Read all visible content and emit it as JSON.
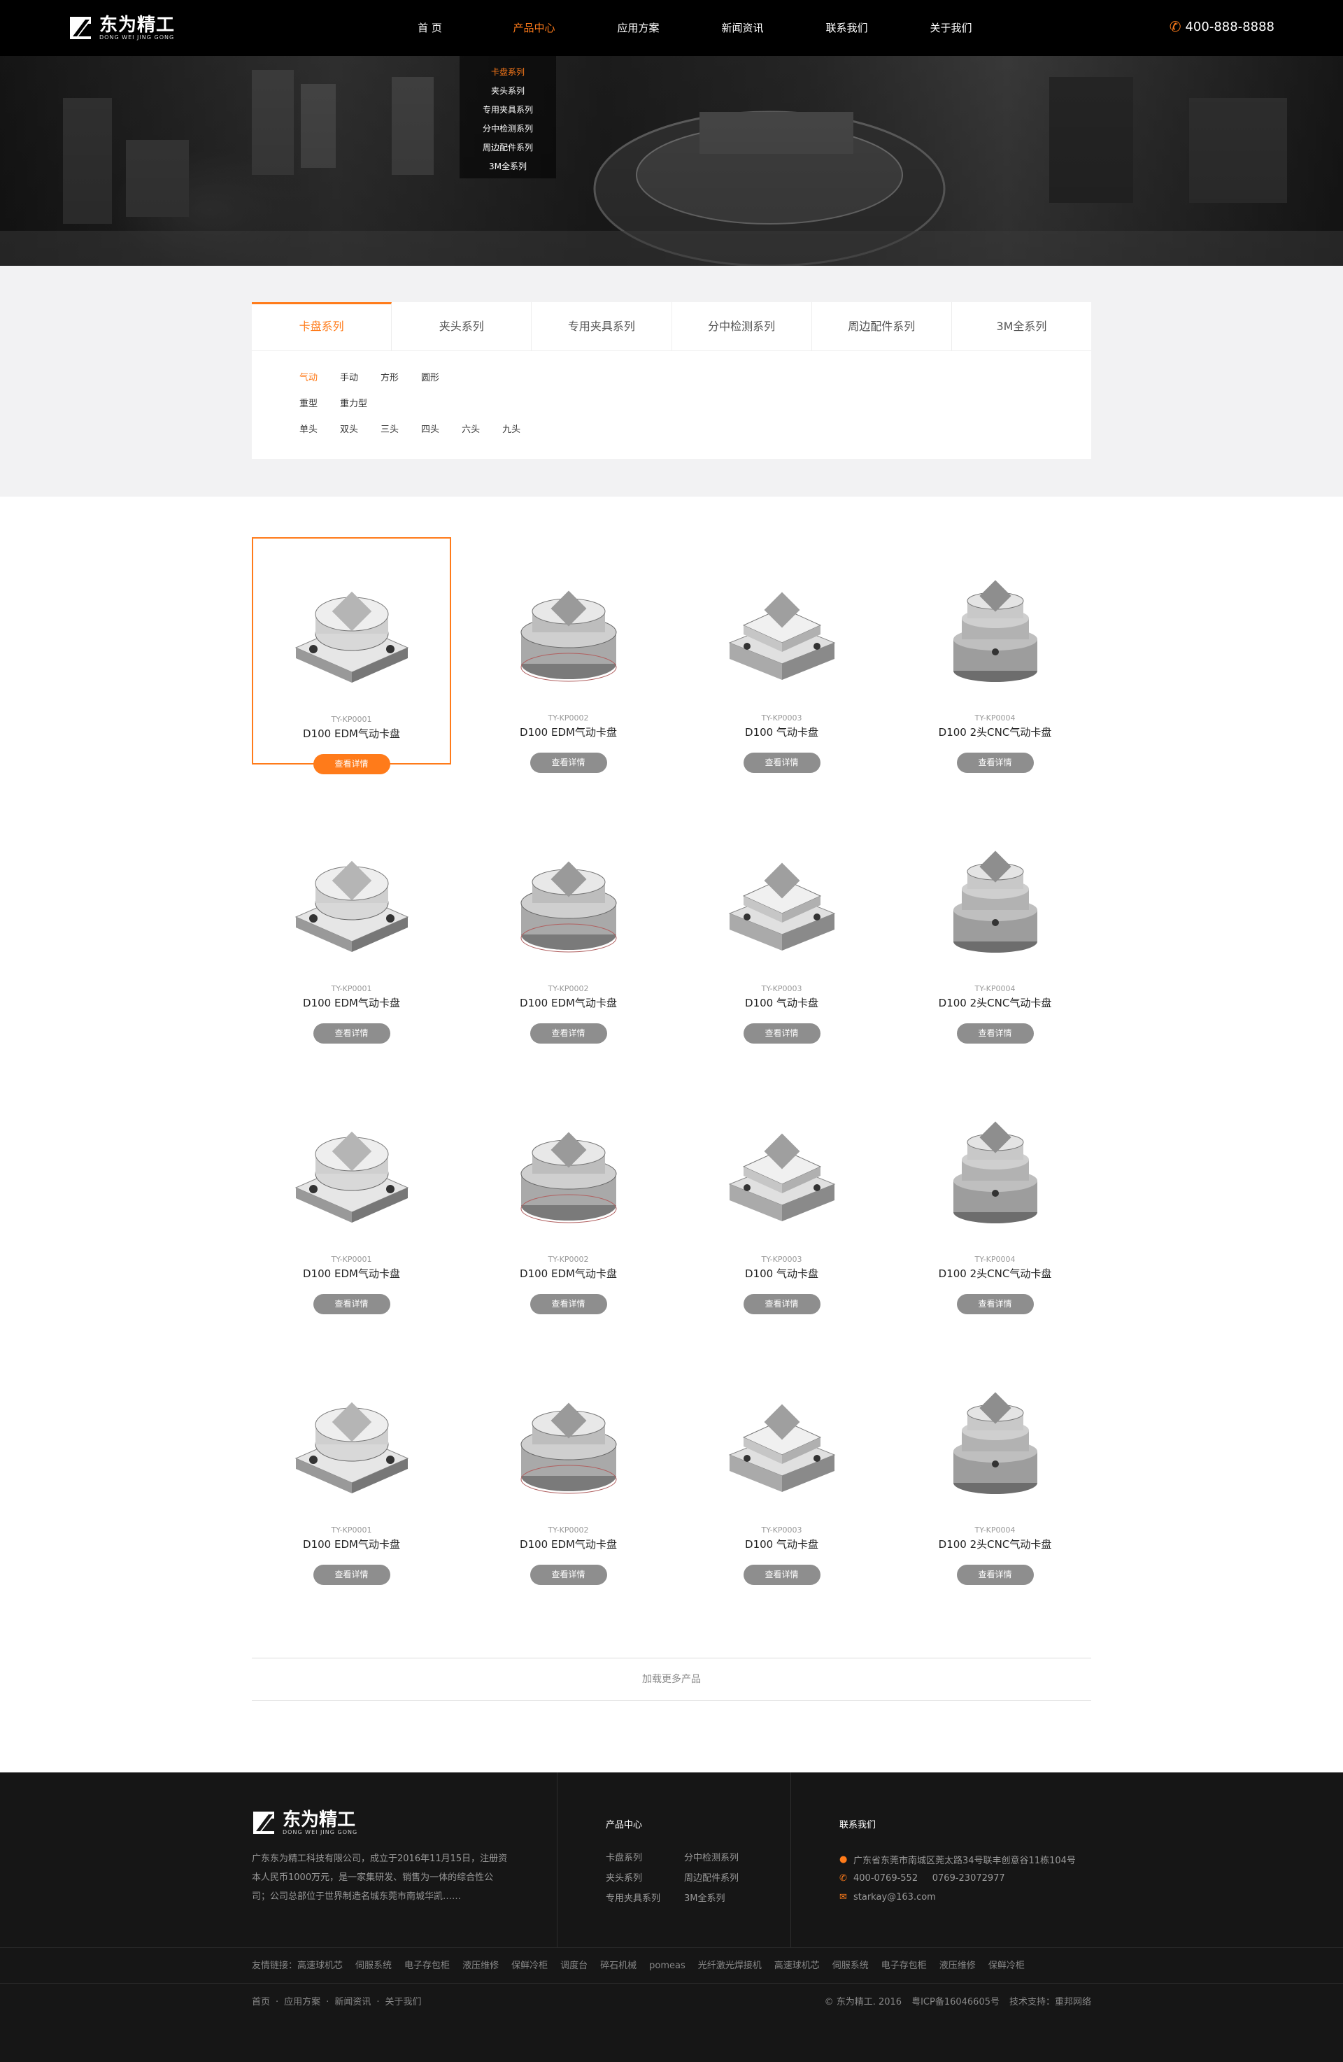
{
  "header": {
    "logo_text": "东为精工",
    "logo_sub": "DONG WEI JING GONG",
    "nav": [
      "首 页",
      "产品中心",
      "应用方案",
      "新闻资讯",
      "联系我们",
      "关于我们"
    ],
    "hotline": "400-888-8888"
  },
  "dropdown": [
    "卡盘系列",
    "夹头系列",
    "专用夹具系列",
    "分中检测系列",
    "周边配件系列",
    "3M全系列"
  ],
  "tabs": [
    "卡盘系列",
    "夹头系列",
    "专用夹具系列",
    "分中检测系列",
    "周边配件系列",
    "3M全系列"
  ],
  "filters": {
    "row1": [
      "气动",
      "手动",
      "方形",
      "圆形"
    ],
    "row2": [
      "重型",
      "重力型"
    ],
    "row3": [
      "单头",
      "双头",
      "三头",
      "四头",
      "六头",
      "九头"
    ]
  },
  "products": [
    {
      "code": "TY-KP0001",
      "name": "D100 EDM气动卡盘",
      "btn": "查看详情"
    },
    {
      "code": "TY-KP0002",
      "name": "D100 EDM气动卡盘",
      "btn": "查看详情"
    },
    {
      "code": "TY-KP0003",
      "name": "D100 气动卡盘",
      "btn": "查看详情"
    },
    {
      "code": "TY-KP0004",
      "name": "D100 2头CNC气动卡盘",
      "btn": "查看详情"
    }
  ],
  "load_more": "加载更多产品",
  "footer": {
    "logo_text": "东为精工",
    "logo_sub": "DONG WEI JING GONG",
    "desc": "广东东为精工科技有限公司，成立于2016年11月15日，注册资本人民币1000万元，是一家集研发、销售为一体的综合性公司；公司总部位于世界制造名城东莞市南城华凯……",
    "col1_title": "产品中心",
    "col1_links": [
      "卡盘系列",
      "分中检测系列",
      "夹头系列",
      "周边配件系列",
      "专用夹具系列",
      "3M全系列"
    ],
    "col2_title": "联系我们",
    "address": "广东省东莞市南城区莞太路34号联丰创意谷11栋104号",
    "phone": "400-0769-552     0769-23072977",
    "email": "starkay@163.com",
    "friend_label": "友情链接：",
    "friend_links": [
      "高速球机芯",
      "伺服系统",
      "电子存包柜",
      "液压维修",
      "保鲜冷柜",
      "调度台",
      "碎石机械",
      "pomeas",
      "光纤激光焊接机",
      "高速球机芯",
      "伺服系统",
      "电子存包柜",
      "液压维修",
      "保鲜冷柜"
    ],
    "bottom_links": [
      "首页",
      "应用方案",
      "新闻资讯",
      "关于我们"
    ],
    "copyright": "© 东为精工. 2016",
    "icp": "粤ICP备16046605号",
    "support": "技术支持：重邦网络"
  },
  "colors": {
    "accent": "#ff7b1a",
    "header_bg": "#000000",
    "footer_bg": "#161616",
    "button_gray": "#8e8e8e"
  }
}
